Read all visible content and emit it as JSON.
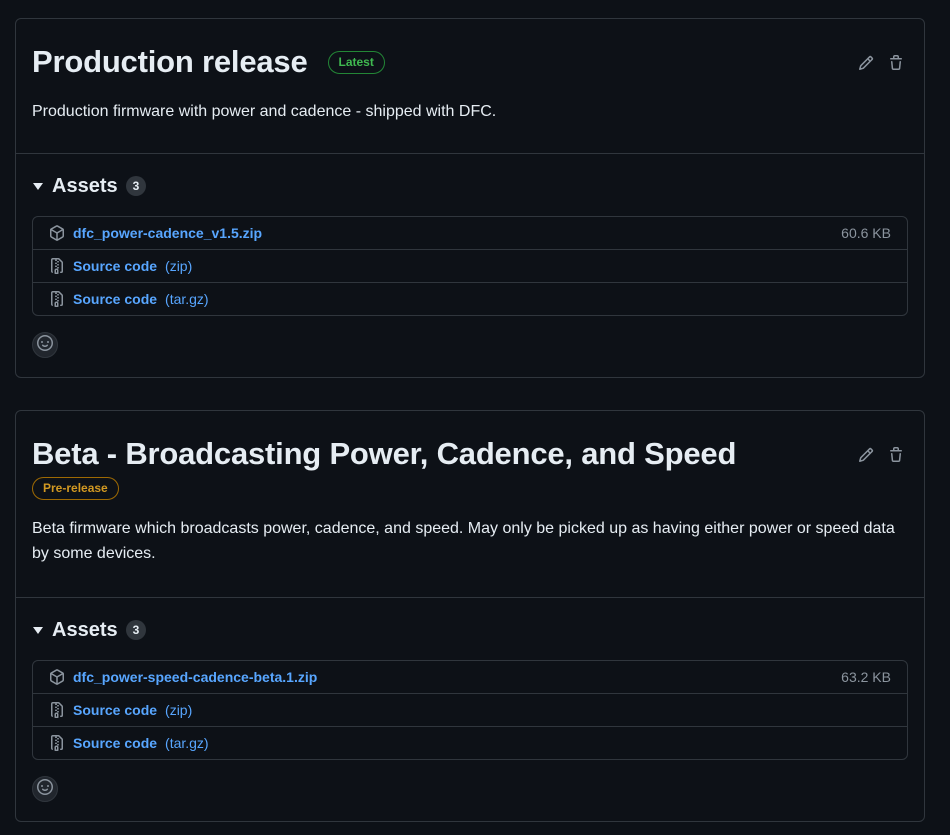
{
  "releases": [
    {
      "title": "Production release",
      "badge": "Latest",
      "description": "Production firmware with power and cadence - shipped with DFC.",
      "assets_label": "Assets",
      "assets_count": "3",
      "assets": [
        {
          "name": "dfc_power-cadence_v1.5.zip",
          "format": "",
          "size": "60.6 KB",
          "icon": "package-icon"
        },
        {
          "name": "Source code",
          "format": "(zip)",
          "size": "",
          "icon": "file-zip-icon"
        },
        {
          "name": "Source code",
          "format": "(tar.gz)",
          "size": "",
          "icon": "file-zip-icon"
        }
      ]
    },
    {
      "title": "Beta - Broadcasting Power, Cadence, and Speed",
      "badge": "Pre-release",
      "description": "Beta firmware which broadcasts power, cadence, and speed. May only be picked up as having either power or speed data by some devices.",
      "assets_label": "Assets",
      "assets_count": "3",
      "assets": [
        {
          "name": "dfc_power-speed-cadence-beta.1.zip",
          "format": "",
          "size": "63.2 KB",
          "icon": "package-icon"
        },
        {
          "name": "Source code",
          "format": "(zip)",
          "size": "",
          "icon": "file-zip-icon"
        },
        {
          "name": "Source code",
          "format": "(tar.gz)",
          "size": "",
          "icon": "file-zip-icon"
        }
      ]
    }
  ],
  "colors": {
    "background": "#0d1117",
    "border": "#30363d",
    "link": "#58a6ff",
    "latest": "#3fb950",
    "prerelease": "#d29922"
  }
}
